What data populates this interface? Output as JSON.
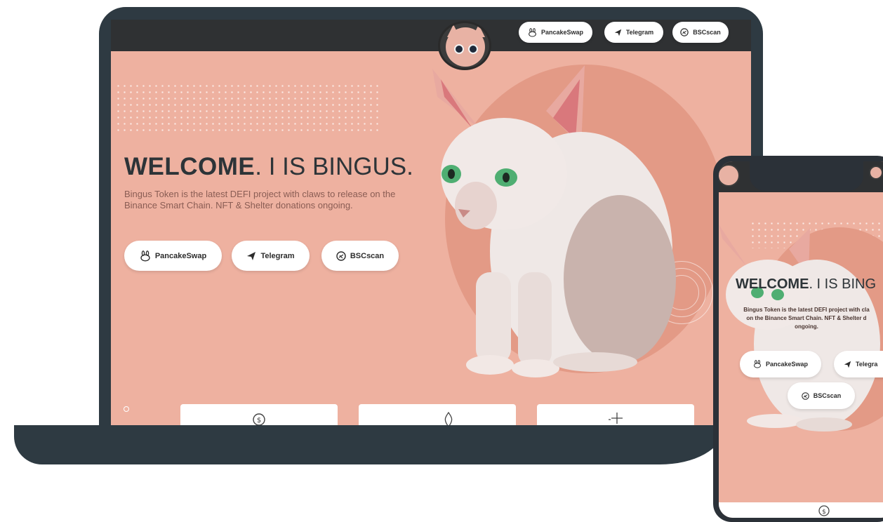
{
  "laptop": {
    "nav": {
      "pancakeswap_label": "PancakeSwap",
      "telegram_label": "Telegram",
      "bscscan_label": "BSCscan"
    },
    "hero": {
      "title_bold": "WELCOME",
      "title_rest": ". I IS BINGUS.",
      "tagline": "Bingus Token is the latest DEFI project with claws to release on the Binance Smart Chain. NFT & Shelter donations ongoing.",
      "pancakeswap_label": "PancakeSwap",
      "telegram_label": "Telegram",
      "bscscan_label": "BSCscan"
    }
  },
  "phone": {
    "hero": {
      "title_bold": "WELCOME",
      "title_rest": ". I IS BING",
      "tagline_line1": "Bingus Token is the latest DEFI project with cla",
      "tagline_line2": "on the Binance Smart Chain. NFT & Shelter d",
      "tagline_line3": "ongoing.",
      "pancakeswap_label": "PancakeSwap",
      "telegram_label": "Telegra",
      "bscscan_label": "BSCscan"
    }
  },
  "colors": {
    "accent": "#eeb1a0",
    "frame": "#2e3a42",
    "header": "#2f3133"
  },
  "icons": [
    "bunny-icon",
    "paper-plane-icon",
    "bscscan-icon",
    "coin-icon",
    "flame-icon",
    "sparkle-icon"
  ]
}
